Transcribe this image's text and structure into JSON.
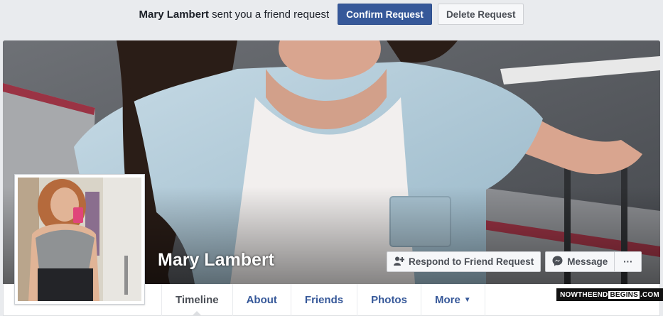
{
  "friend_request": {
    "requester_name": "Mary Lambert",
    "message": "sent you a friend request",
    "confirm_label": "Confirm Request",
    "delete_label": "Delete Request"
  },
  "profile": {
    "name": "Mary Lambert",
    "respond_label": "Respond to Friend Request",
    "message_label": "Message",
    "more_actions_label": "···"
  },
  "nav": {
    "tabs": [
      {
        "label": "Timeline",
        "active": true
      },
      {
        "label": "About"
      },
      {
        "label": "Friends"
      },
      {
        "label": "Photos"
      },
      {
        "label": "More"
      }
    ]
  },
  "watermark": {
    "prefix": "NOWTHEEND",
    "highlight": "BEGINS",
    "suffix": ".COM"
  },
  "colors": {
    "primary": "#365899",
    "background": "#e9ebee",
    "nav_text": "#365899"
  }
}
